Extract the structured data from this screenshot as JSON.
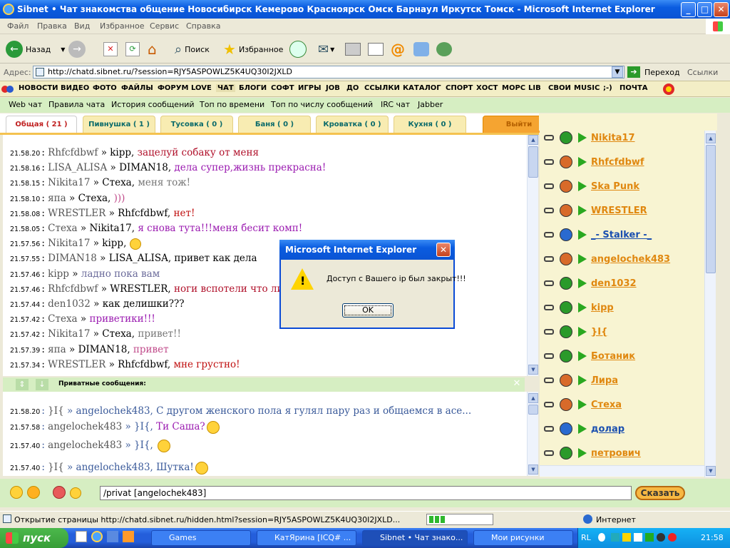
{
  "window": {
    "title": "Sibnet • Чат знакомства общение Новосибирск Кемерово Красноярск Омск Барнаул Иркутск Томск - Microsoft Internet Explorer",
    "minimize": "_",
    "maximize": "□",
    "close": "✕"
  },
  "menu": [
    "Файл",
    "Правка",
    "Вид",
    "Избранное",
    "Сервис",
    "Справка"
  ],
  "toolbar": {
    "back": "Назад",
    "search": "Поиск",
    "favorites": "Избранное"
  },
  "address": {
    "label": "Адрес:",
    "url": "http://chatd.sibnet.ru/?session=RJY5ASPOWLZ5K4UQ30I2JXLD",
    "go": "Переход",
    "links": "Ссылки"
  },
  "sitenav": [
    "НОВОСТИ",
    "ВИДЕО",
    "ФОТО",
    "ФАЙЛЫ",
    "ФОРУМ",
    "LOVE",
    "ЧАТ",
    "БЛОГИ",
    "СОФТ",
    "ИГРЫ",
    "JOB",
    "ДО",
    "ССЫЛКИ",
    "КАТАЛОГ",
    "СПОРТ",
    "ХОСТ",
    "МОРС",
    "LIB",
    "СВОИ",
    "MUSIC",
    ";-)",
    "ПОЧТА"
  ],
  "subnav": [
    "Web чат",
    "Правила чата",
    "История сообщений",
    "Топ по времени",
    "Топ по числу сообщений",
    "IRC чат",
    "Jabber"
  ],
  "tabs": [
    {
      "label": "Общая ( 21 )"
    },
    {
      "label": "Пивнушка ( 1 )"
    },
    {
      "label": "Тусовка ( 0 )"
    },
    {
      "label": "Баня ( 0 )"
    },
    {
      "label": "Кроватка ( 0 )"
    },
    {
      "label": "Кухня ( 0 )"
    },
    {
      "label": "Выйти"
    }
  ],
  "messages": [
    {
      "time": "21.58.20",
      "from": "Rhfcfdbwf",
      "to": "kipp",
      "text": "зацелуй собаку от меня",
      "color": "#b0102a"
    },
    {
      "time": "21.58.16",
      "from": "LISA_ALISA",
      "to": "DIMAN18",
      "text": "дела супер,жизнь прекрасна!",
      "color": "#9a1ab0"
    },
    {
      "time": "21.58.15",
      "from": "Nikita17",
      "to": "Стеха",
      "text": "меня тож!",
      "color": "#777"
    },
    {
      "time": "21.58.10",
      "from": "япа",
      "to": "Стеха",
      "text": ")))",
      "color": "#c04a8a"
    },
    {
      "time": "21.58.08",
      "from": "WRESTLER",
      "to": "Rhfcfdbwf",
      "text": "нет!",
      "color": "#c01010"
    },
    {
      "time": "21.58.05",
      "from": "Стеха",
      "to": "Nikita17",
      "text": "я снова тута!!!меня бесит комп!",
      "color": "#9a1ab0"
    },
    {
      "time": "21.57.56",
      "from": "Nikita17",
      "to": "kipp",
      "text": "",
      "color": "#777"
    },
    {
      "time": "21.57.55",
      "from": "DIMAN18",
      "to": "LISA_ALISA",
      "text": "привет как дела",
      "color": "#000"
    },
    {
      "time": "21.57.46",
      "from": "kipp",
      "to": "",
      "text": "ладно пока вам",
      "color": "#6a6a9a"
    },
    {
      "time": "21.57.46",
      "from": "Rhfcfdbwf",
      "to": "WRESTLER",
      "text": "ноги вспотели что ли",
      "color": "#b0102a"
    },
    {
      "time": "21.57.44",
      "from": "den1032",
      "to": "",
      "text": "как делишки???",
      "color": "#000"
    },
    {
      "time": "21.57.42",
      "from": "Стеха",
      "to": "",
      "text": "приветики!!!",
      "color": "#9a1ab0"
    },
    {
      "time": "21.57.42",
      "from": "Nikita17",
      "to": "Стеха",
      "text": "привет!!",
      "color": "#777"
    },
    {
      "time": "21.57.39",
      "from": "япа",
      "to": "DIMAN18",
      "text": "привет",
      "color": "#c04a8a"
    },
    {
      "time": "21.57.34",
      "from": "WRESTLER",
      "to": "Rhfcfdbwf",
      "text": "мне грустно!",
      "color": "#c01010"
    }
  ],
  "private_bar": {
    "label": "Приватные сообщения:"
  },
  "private_messages": [
    {
      "time": "21.58.20",
      "from": "}I{",
      "to": "angelochek483",
      "text": "С другом женского пола я гулял пару раз и общаемся в асе...",
      "color": "#3a5a9a"
    },
    {
      "time": "21.57.58",
      "from": "angelochek483",
      "to": "}I{",
      "text": "Ти Саша?",
      "color": "#9a1ab0"
    },
    {
      "time": "21.57.40",
      "from": "angelochek483",
      "to": "}I{",
      "text": "",
      "color": "#3a5a9a"
    },
    {
      "time": "21.57.40",
      "from": "}I{",
      "to": "angelochek483",
      "text": "Шутка!",
      "color": "#3a5a9a"
    }
  ],
  "users": [
    {
      "name": "Nikita17",
      "av": "g",
      "blue": false
    },
    {
      "name": "Rhfcfdbwf",
      "av": "o",
      "blue": false
    },
    {
      "name": "Ska Punk",
      "av": "o",
      "blue": false
    },
    {
      "name": "WRESTLER",
      "av": "o",
      "blue": false
    },
    {
      "name": "_- Stalker -_",
      "av": "b",
      "blue": true
    },
    {
      "name": "angelochek483",
      "av": "o",
      "blue": false
    },
    {
      "name": "den1032",
      "av": "g",
      "blue": false
    },
    {
      "name": "kipp",
      "av": "g",
      "blue": false
    },
    {
      "name": "}I{",
      "av": "g",
      "blue": false
    },
    {
      "name": "Ботаник",
      "av": "g",
      "blue": false
    },
    {
      "name": "Лира",
      "av": "o",
      "blue": false
    },
    {
      "name": "Стеха",
      "av": "o",
      "blue": false
    },
    {
      "name": "долар",
      "av": "b",
      "blue": true
    },
    {
      "name": "петрович",
      "av": "g",
      "blue": false
    }
  ],
  "input": {
    "value": "/privat [angelochek483]",
    "send": "Сказать"
  },
  "status": {
    "text": "Открытие страницы http://chatd.sibnet.ru/hidden.html?session=RJY5ASPOWLZ5K4UQ30I2JXLD...",
    "zone": "Интернет",
    "progress": 0.3
  },
  "taskbar": {
    "start": "пуск",
    "tasks": [
      "Games",
      "КатЯрина   [ICQ# ...",
      "Sibnet • Чат знако...",
      "Мои рисунки"
    ],
    "lang": "RL",
    "clock": "21:58"
  },
  "dialog": {
    "title": "Microsoft Internet Explorer",
    "message": "Доступ с Вашего ip был закрыт!!!",
    "ok": "OK"
  }
}
